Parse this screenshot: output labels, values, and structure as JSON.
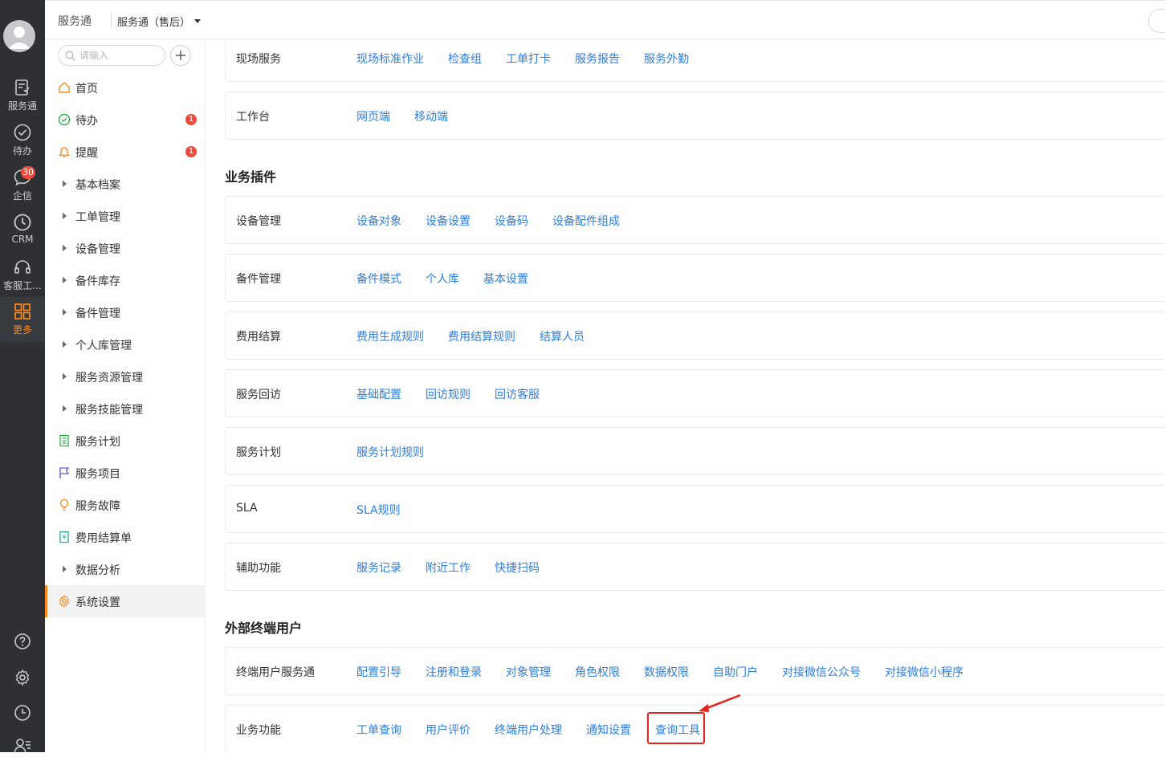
{
  "topbar": {
    "app_name": "服务通",
    "app_sub": "服务通（售后）"
  },
  "rail": {
    "items": [
      {
        "label": "服务通",
        "icon": "service-icon"
      },
      {
        "label": "待办",
        "icon": "check-circle-icon"
      },
      {
        "label": "企信",
        "icon": "chat-icon",
        "badge": "30"
      },
      {
        "label": "CRM",
        "icon": "clock-icon"
      },
      {
        "label": "客服工...",
        "icon": "headset-icon"
      },
      {
        "label": "更多",
        "icon": "grid-icon"
      }
    ],
    "active": "更多"
  },
  "sidebar": {
    "search_placeholder": "请输入",
    "items": [
      {
        "label": "首页",
        "icon": "home-icon"
      },
      {
        "label": "待办",
        "icon": "check-icon",
        "badge": "1"
      },
      {
        "label": "提醒",
        "icon": "bell-icon",
        "badge": "1"
      },
      {
        "label": "基本档案",
        "icon": "caret-right-icon"
      },
      {
        "label": "工单管理",
        "icon": "caret-right-icon"
      },
      {
        "label": "设备管理",
        "icon": "caret-right-icon"
      },
      {
        "label": "备件库存",
        "icon": "caret-right-icon"
      },
      {
        "label": "备件管理",
        "icon": "caret-right-icon"
      },
      {
        "label": "个人库管理",
        "icon": "caret-right-icon"
      },
      {
        "label": "服务资源管理",
        "icon": "caret-right-icon"
      },
      {
        "label": "服务技能管理",
        "icon": "caret-right-icon"
      },
      {
        "label": "服务计划",
        "icon": "list-doc-icon"
      },
      {
        "label": "服务项目",
        "icon": "flag-icon"
      },
      {
        "label": "服务故障",
        "icon": "bulb-icon"
      },
      {
        "label": "费用结算单",
        "icon": "receipt-icon"
      },
      {
        "label": "数据分析",
        "icon": "caret-right-icon"
      },
      {
        "label": "系统设置",
        "icon": "gear-icon"
      }
    ],
    "active": "系统设置"
  },
  "main": {
    "cards_top": [
      {
        "title": "现场服务",
        "links": [
          "现场标准作业",
          "检查组",
          "工单打卡",
          "服务报告",
          "服务外勤"
        ]
      },
      {
        "title": "工作台",
        "links": [
          "网页端",
          "移动端"
        ]
      }
    ],
    "group_plugins": {
      "title": "业务插件",
      "cards": [
        {
          "title": "设备管理",
          "links": [
            "设备对象",
            "设备设置",
            "设备码",
            "设备配件组成"
          ]
        },
        {
          "title": "备件管理",
          "links": [
            "备件模式",
            "个人库",
            "基本设置"
          ]
        },
        {
          "title": "费用结算",
          "links": [
            "费用生成规则",
            "费用结算规则",
            "结算人员"
          ]
        },
        {
          "title": "服务回访",
          "links": [
            "基础配置",
            "回访规则",
            "回访客服"
          ]
        },
        {
          "title": "服务计划",
          "links": [
            "服务计划规则"
          ]
        },
        {
          "title": "SLA",
          "links": [
            "SLA规则"
          ]
        },
        {
          "title": "辅助功能",
          "links": [
            "服务记录",
            "附近工作",
            "快捷扫码"
          ]
        }
      ]
    },
    "group_external": {
      "title": "外部终端用户",
      "cards": [
        {
          "title": "终端用户服务通",
          "links": [
            "配置引导",
            "注册和登录",
            "对象管理",
            "角色权限",
            "数据权限",
            "自助门户",
            "对接微信公众号",
            "对接微信小程序"
          ]
        },
        {
          "title": "业务功能",
          "links": [
            "工单查询",
            "用户评价",
            "终端用户处理",
            "通知设置",
            "查询工具"
          ]
        }
      ]
    },
    "highlight_color": "#e8221b",
    "link_color": "#2d7ee0",
    "accent_color": "#ff8a1f"
  }
}
